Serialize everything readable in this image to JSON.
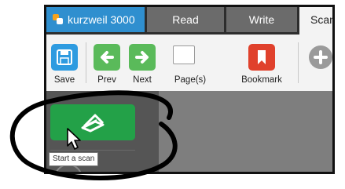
{
  "app": {
    "name": "kurzweil 3000"
  },
  "tabs": [
    {
      "label": "Read"
    },
    {
      "label": "Write"
    },
    {
      "label": "Scan"
    }
  ],
  "toolbar": {
    "save_label": "Save",
    "prev_label": "Prev",
    "next_label": "Next",
    "pages_label": "Page(s)",
    "bookmark_label": "Bookmark"
  },
  "sidebar": {
    "scan_button_icon": "scanner-icon"
  },
  "tooltip": {
    "text": "Start a scan"
  },
  "colors": {
    "brand_blue": "#2f8fcf",
    "scan_green": "#23a148",
    "bookmark_red": "#e0412c",
    "nav_green": "#5aba5a",
    "save_blue": "#2e9be0"
  }
}
